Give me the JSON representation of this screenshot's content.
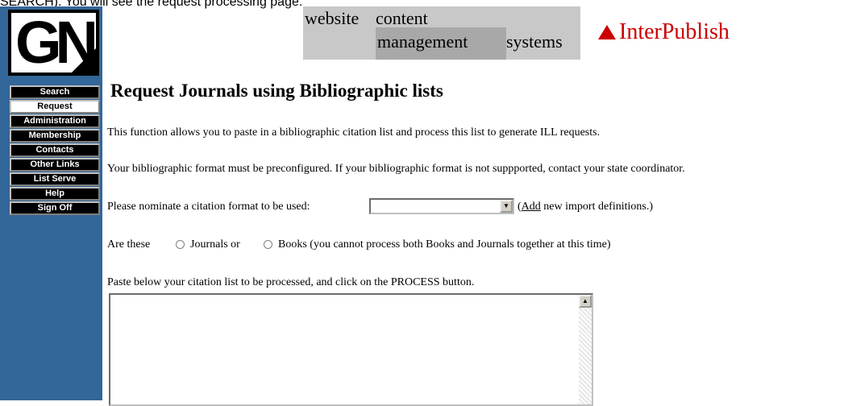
{
  "caption": "SEARCH). You will see the request processing page.",
  "logo": {
    "text": "GN"
  },
  "nav": [
    {
      "label": "Search"
    },
    {
      "label": "Request"
    },
    {
      "label": "Administration"
    },
    {
      "label": "Membership"
    },
    {
      "label": "Contacts"
    },
    {
      "label": "Other Links"
    },
    {
      "label": "List Serve"
    },
    {
      "label": "Help"
    },
    {
      "label": "Sign Off"
    }
  ],
  "banner": {
    "w1": "website",
    "w2": "content",
    "w3": "management",
    "w4": "systems"
  },
  "interpublish": "InterPublish",
  "page": {
    "title": "Request Journals using Bibliographic lists",
    "intro": "This function allows you to paste in a bibliographic citation list and process this list to generate ILL requests.",
    "format_note": "Your bibliographic format must be preconfigured. If your bibliographic format is not suppported, contact your state coordinator.",
    "nominate_label": "Please nominate a citation format to be used:",
    "select_value": "",
    "add_paren_open": "(",
    "add_link": "Add",
    "add_rest": " new import definitions.)",
    "are_these": "Are these",
    "journals": "Journals or",
    "books": "Books (you cannot process both Books and Journals together at this time)",
    "paste_label": "Paste below your citation list to be processed, and click on the PROCESS button.",
    "textarea_value": ""
  },
  "icons": {
    "select_arrow": "▼",
    "scroll_up": "▲"
  },
  "colors": {
    "sidebar": "#336699",
    "brand": "#cc0000"
  }
}
